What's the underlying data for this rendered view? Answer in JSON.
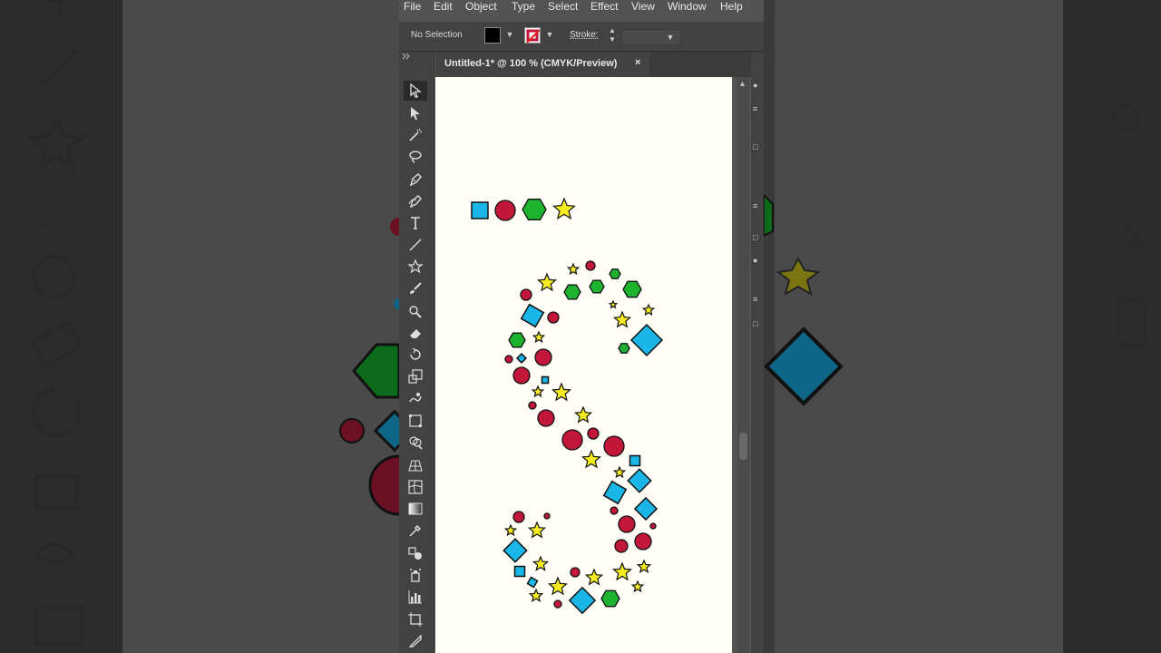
{
  "menu": {
    "items": [
      "File",
      "Edit",
      "Object",
      "Type",
      "Select",
      "Effect",
      "View",
      "Window",
      "Help"
    ]
  },
  "control_bar": {
    "selection_status": "No Selection",
    "stroke_label": "Stroke:"
  },
  "document_tab": {
    "title": "Untitled-1* @ 100 % (CMYK/Preview)",
    "close_glyph": "×"
  },
  "toolbar": {
    "tools": [
      "selection-tool",
      "direct-selection-tool",
      "magic-wand-tool",
      "lasso-tool",
      "pen-tool",
      "curvature-tool",
      "type-tool",
      "line-segment-tool",
      "star-tool",
      "paintbrush-tool",
      "shaper-tool",
      "eraser-tool",
      "rotate-tool",
      "scale-tool",
      "warp-tool",
      "free-transform-tool",
      "shape-builder-tool",
      "perspective-grid-tool",
      "mesh-tool",
      "gradient-tool",
      "eyedropper-tool",
      "blend-tool",
      "symbol-sprayer-tool",
      "column-graph-tool",
      "artboard-tool",
      "slice-tool"
    ]
  },
  "colors": {
    "square": "#1ab6e8",
    "circle": "#c3173a",
    "hexagon": "#1db32e",
    "star": "#f6ec1f",
    "outline": "#111111",
    "artboard": "#fffef7",
    "app_bg": "#535353"
  },
  "artwork": {
    "symbol_set": [
      "square",
      "circle",
      "hexagon",
      "star"
    ]
  }
}
